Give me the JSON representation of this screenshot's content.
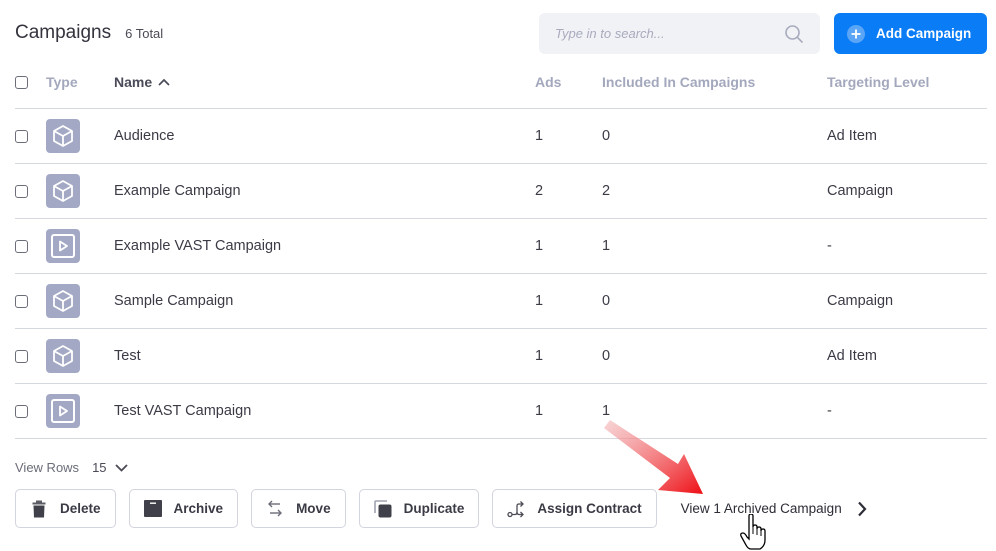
{
  "header": {
    "title": "Campaigns",
    "total": "6 Total"
  },
  "search": {
    "placeholder": "Type in to search..."
  },
  "add_button": {
    "label": "Add Campaign"
  },
  "table": {
    "columns": {
      "type": "Type",
      "name": "Name",
      "ads": "Ads",
      "included": "Included In Campaigns",
      "targeting": "Targeting Level"
    },
    "sort": {
      "column": "name",
      "direction": "ascending"
    },
    "rows": [
      {
        "type_icon": "cube-icon",
        "name": "Audience",
        "ads": "1",
        "included": "0",
        "targeting": "Ad Item"
      },
      {
        "type_icon": "cube-icon",
        "name": "Example Campaign",
        "ads": "2",
        "included": "2",
        "targeting": "Campaign"
      },
      {
        "type_icon": "video-play-icon",
        "name": "Example VAST Campaign",
        "ads": "1",
        "included": "1",
        "targeting": "-"
      },
      {
        "type_icon": "cube-icon",
        "name": "Sample Campaign",
        "ads": "1",
        "included": "0",
        "targeting": "Campaign"
      },
      {
        "type_icon": "cube-icon",
        "name": "Test",
        "ads": "1",
        "included": "0",
        "targeting": "Ad Item"
      },
      {
        "type_icon": "video-play-icon",
        "name": "Test VAST Campaign",
        "ads": "1",
        "included": "1",
        "targeting": "-"
      }
    ]
  },
  "pagination": {
    "view_rows_label": "View Rows",
    "view_rows_value": "15"
  },
  "actions": {
    "delete": "Delete",
    "archive": "Archive",
    "move": "Move",
    "duplicate": "Duplicate",
    "assign_contract": "Assign Contract",
    "view_archived": "View 1 Archived Campaign"
  },
  "colors": {
    "accent": "#0a7cf5",
    "type_icon_bg": "#a3a9c4",
    "annotation_arrow": "#e8141a"
  }
}
